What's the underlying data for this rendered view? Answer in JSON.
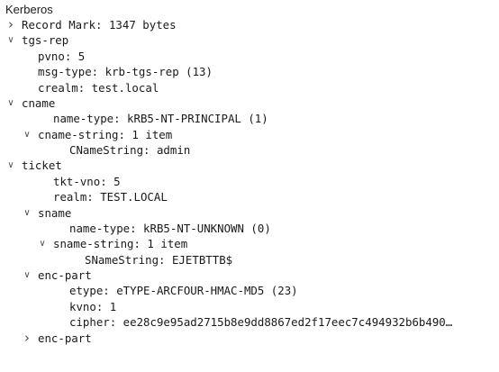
{
  "header": {
    "title": "Kerberos"
  },
  "tree": [
    {
      "text": "Record Mark: 1347 bytes",
      "depth": 0,
      "toggle": "collapsed"
    },
    {
      "text": "tgs-rep",
      "depth": 0,
      "toggle": "expanded"
    },
    {
      "text": "pvno: 5",
      "depth": 1,
      "toggle": "none"
    },
    {
      "text": "msg-type: krb-tgs-rep (13)",
      "depth": 1,
      "toggle": "none"
    },
    {
      "text": "crealm: test.local",
      "depth": 1,
      "toggle": "none"
    },
    {
      "text": "cname",
      "depth": 0,
      "toggle": "expanded"
    },
    {
      "text": "name-type: kRB5-NT-PRINCIPAL (1)",
      "depth": 2,
      "toggle": "none"
    },
    {
      "text": "cname-string: 1 item",
      "depth": 1,
      "toggle": "expanded"
    },
    {
      "text": "CNameString: admin",
      "depth": 3,
      "toggle": "none"
    },
    {
      "text": "ticket",
      "depth": 0,
      "toggle": "expanded"
    },
    {
      "text": "tkt-vno: 5",
      "depth": 2,
      "toggle": "none"
    },
    {
      "text": "realm: TEST.LOCAL",
      "depth": 2,
      "toggle": "none"
    },
    {
      "text": "sname",
      "depth": 1,
      "toggle": "expanded"
    },
    {
      "text": "name-type: kRB5-NT-UNKNOWN (0)",
      "depth": 3,
      "toggle": "none"
    },
    {
      "text": "sname-string: 1 item",
      "depth": 2,
      "toggle": "expanded"
    },
    {
      "text": "SNameString: EJETBTTB$",
      "depth": 4,
      "toggle": "none"
    },
    {
      "text": "enc-part",
      "depth": 1,
      "toggle": "expanded"
    },
    {
      "text": "etype: eTYPE-ARCFOUR-HMAC-MD5 (23)",
      "depth": 3,
      "toggle": "none"
    },
    {
      "text": "kvno: 1",
      "depth": 3,
      "toggle": "none"
    },
    {
      "text": "cipher: ee28c9e95ad2715b8e9dd8867ed2f17eec7c494932b6b490…",
      "depth": 3,
      "toggle": "none"
    },
    {
      "text": "enc-part",
      "depth": 1,
      "toggle": "collapsed"
    }
  ]
}
